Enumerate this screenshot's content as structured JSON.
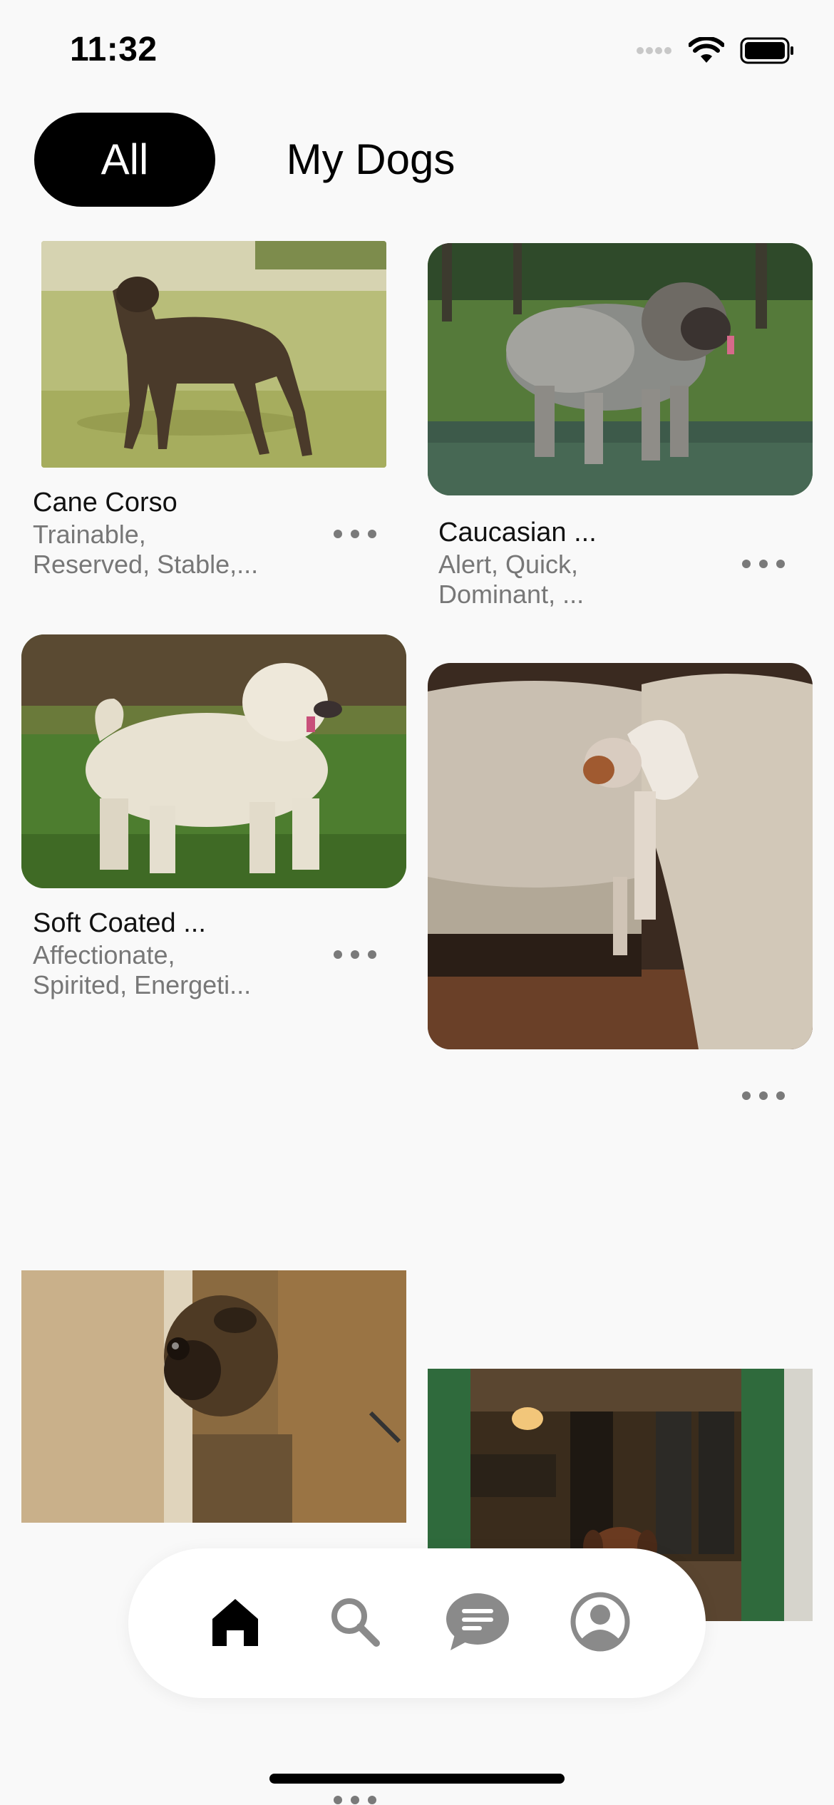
{
  "status": {
    "time": "11:32",
    "icons": [
      "signal-icon",
      "wifi-icon",
      "battery-icon"
    ]
  },
  "tabs": [
    {
      "label": "All",
      "selected": true
    },
    {
      "label": "My Dogs",
      "selected": false
    }
  ],
  "cards": [
    {
      "title": "Cane Corso",
      "subtitle": "Trainable,\nReserved, Stable,...",
      "image": "brindle-dog-photo"
    },
    {
      "title": "Caucasian ...",
      "subtitle": "Alert, Quick,\nDominant, ...",
      "image": "fluffy-grey-dog-photo"
    },
    {
      "title": "Soft Coated ...",
      "subtitle": "Affectionate,\nSpirited, Energeti...",
      "image": "white-terrier-photo"
    },
    {
      "title": "",
      "subtitle": "",
      "image": "chihuahua-on-couch-photo"
    },
    {
      "title": "",
      "subtitle": "",
      "image": "pug-peeking-photo"
    },
    {
      "title": "",
      "subtitle": "",
      "image": "shepherd-in-bar-photo"
    }
  ],
  "nav": {
    "items": [
      {
        "name": "home",
        "icon": "home-icon",
        "active": true
      },
      {
        "name": "search",
        "icon": "search-icon",
        "active": false
      },
      {
        "name": "messages",
        "icon": "chat-bubble-icon",
        "active": false
      },
      {
        "name": "profile",
        "icon": "profile-icon",
        "active": false
      }
    ]
  },
  "colors": {
    "background": "#f9f9f9",
    "tab_selected_bg": "#000000",
    "tab_selected_text": "#ffffff",
    "subtitle_text": "#777777",
    "icon_active": "#000000",
    "icon_inactive": "#8a8a8a"
  }
}
